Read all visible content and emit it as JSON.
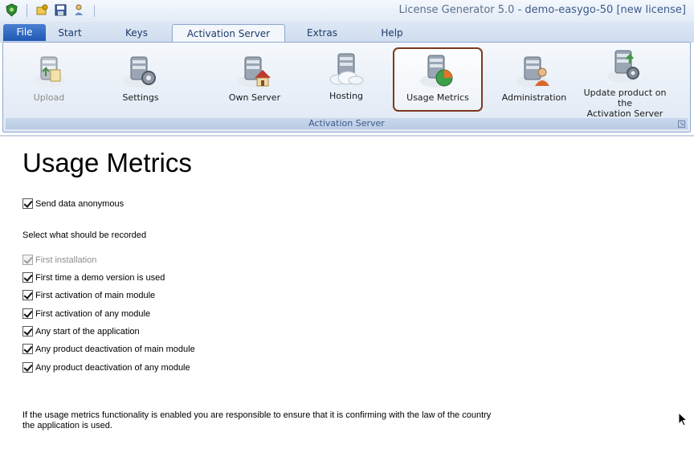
{
  "window": {
    "app_title": "License Generator 5.0",
    "separator": " - ",
    "document": "demo-easygo-50 [new license]"
  },
  "quick_access": [
    "app-shield-icon",
    "open-keys-icon",
    "save-icon",
    "user-search-icon"
  ],
  "tabs": [
    {
      "label": "File",
      "active": false
    },
    {
      "label": "Start",
      "active": false
    },
    {
      "label": "Keys",
      "active": false
    },
    {
      "label": "Activation Server",
      "active": true
    },
    {
      "label": "Extras",
      "active": false
    },
    {
      "label": "Help",
      "active": false
    }
  ],
  "ribbon": {
    "group_label": "Activation Server",
    "buttons": [
      {
        "label": "Upload",
        "icon": "server-upload-icon",
        "enabled": false
      },
      {
        "label": "Settings",
        "icon": "server-gear-icon",
        "enabled": true
      },
      {
        "label": "Own Server",
        "icon": "server-home-icon",
        "enabled": true
      },
      {
        "label": "Hosting",
        "icon": "server-cloud-icon",
        "enabled": true
      },
      {
        "label": "Usage Metrics",
        "icon": "server-chart-icon",
        "enabled": true,
        "selected": true
      },
      {
        "label": "Administration",
        "icon": "server-admin-icon",
        "enabled": true
      },
      {
        "label": "Update product on the Activation Server",
        "line1": "Update product on the",
        "line2": "Activation Server",
        "icon": "server-update-icon",
        "enabled": true
      }
    ]
  },
  "content": {
    "title": "Usage Metrics",
    "send_anonymous": {
      "label": "Send data anonymous",
      "checked": true
    },
    "select_label": "Select what should be recorded",
    "options": [
      {
        "label": "First installation",
        "checked": true,
        "enabled": false
      },
      {
        "label": "First time a demo version is used",
        "checked": true,
        "enabled": true
      },
      {
        "label": "First activation of main module",
        "checked": true,
        "enabled": true
      },
      {
        "label": "First activation of any module",
        "checked": true,
        "enabled": true
      },
      {
        "label": "Any start of the application",
        "checked": true,
        "enabled": true
      },
      {
        "label": "Any product deactivation of main module",
        "checked": true,
        "enabled": true
      },
      {
        "label": "Any product deactivation of any module",
        "checked": true,
        "enabled": true
      }
    ],
    "note_line1": "If the usage metrics functionality is enabled you are responsible to ensure that it is confirming with the law of the country",
    "note_line2": "the application is used."
  },
  "colors": {
    "selected_border": "#7b3a1e",
    "file_tab": "#2a63bd"
  }
}
